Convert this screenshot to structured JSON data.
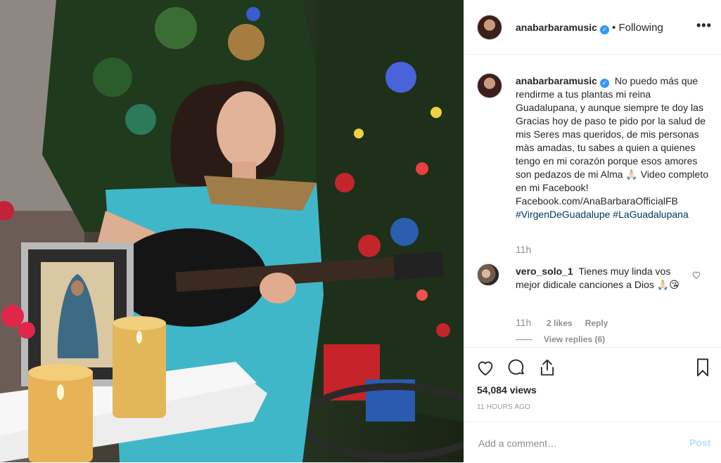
{
  "post": {
    "username": "anabarbaramusic",
    "verified_icon": "verified-badge-icon",
    "follow_separator": "•",
    "follow_state": "Following",
    "more_icon": "more-options-icon"
  },
  "caption": {
    "username": "anabarbaramusic",
    "text_main": "No puedo más que rendirme a tus plantas mi reina Guadalupana, y aunque siempre te doy las Gracias hoy de paso te pido por la salud de mis Seres mas queridos, de mis personas màs amadas, tu sabes a quien a quienes tengo en mi corazón porque esos amores son pedazos de mi Alma 🙏🏻 Video completo en mi Facebook! Facebook.com/AnaBarbaraOfficialFB",
    "hashtag_1": "#VirgenDeGuadalupe",
    "hashtag_2": "#LaGuadalupana",
    "time": "11h"
  },
  "reply": {
    "username": "vero_solo_1",
    "text": "Tienes muy linda vos mejor didicale canciones a Dios 🙏🏻😘",
    "time": "11h",
    "likes": "2 likes",
    "reply_label": "Reply",
    "view_replies": "View replies (6)"
  },
  "actions": {
    "views": "54,084 views",
    "time_ago": "11 HOURS AGO"
  },
  "comment_box": {
    "placeholder": "Add a comment…",
    "post_label": "Post"
  },
  "colors": {
    "link": "#003569",
    "verified": "#3897f0",
    "post_disabled": "#b2dffc",
    "muted": "#8e8e8e"
  }
}
